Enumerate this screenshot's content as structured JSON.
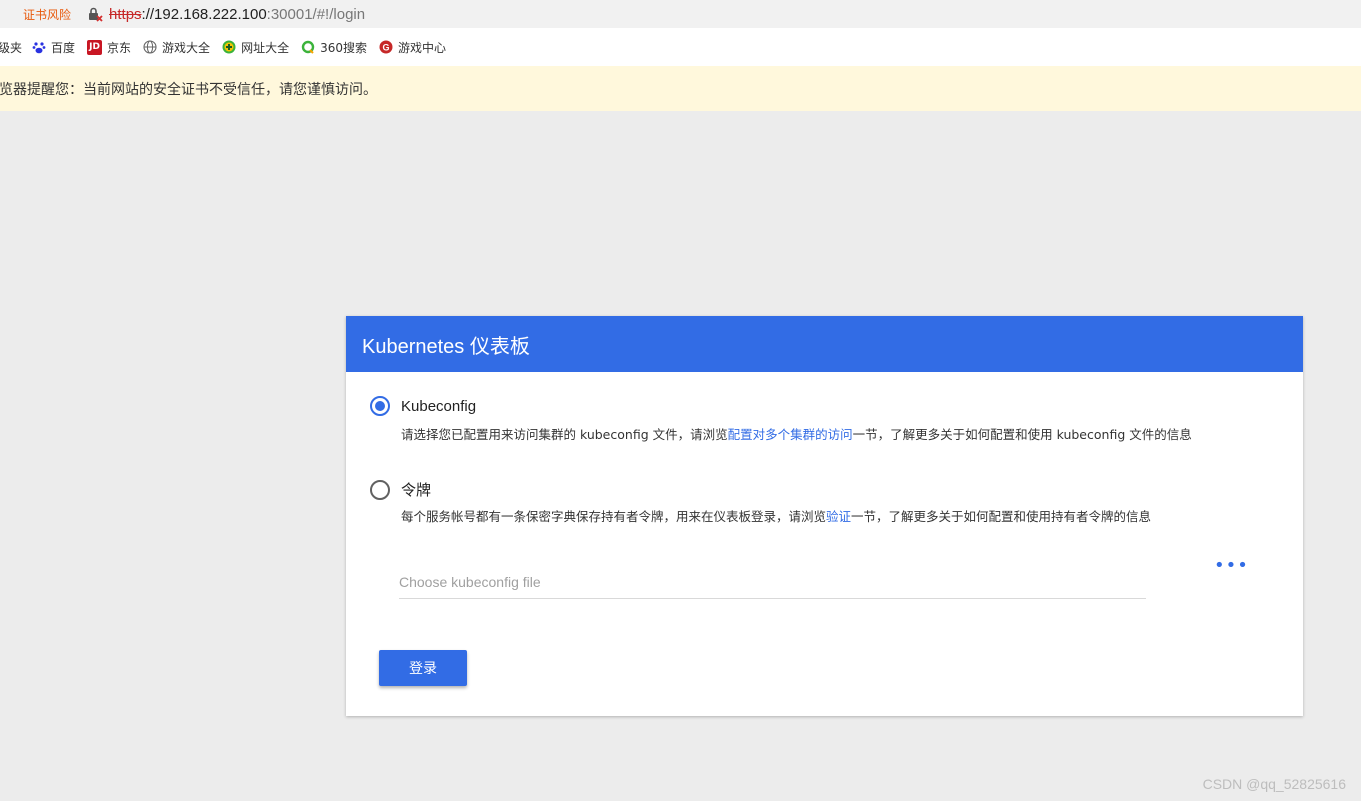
{
  "browser": {
    "cert_warning": "证书风险",
    "url_scheme": "https",
    "url_host": "://192.168.222.100",
    "url_rest": ":30001/#!/login",
    "bookmarks": [
      {
        "label": "级夹",
        "icon": "folder-icon"
      },
      {
        "label": "百度",
        "icon": "baidu-icon"
      },
      {
        "label": "京东",
        "icon": "jd-icon"
      },
      {
        "label": "游戏大全",
        "icon": "globe-icon"
      },
      {
        "label": "网址大全",
        "icon": "plus-circle-icon"
      },
      {
        "label": "360搜索",
        "icon": "search360-icon"
      },
      {
        "label": "游戏中心",
        "icon": "game-center-icon"
      }
    ],
    "security_warning": "览器提醒您：当前网站的安全证书不受信任，请您谨慎访问。"
  },
  "login": {
    "title": "Kubernetes 仪表板",
    "options": [
      {
        "label": "Kubeconfig",
        "selected": true,
        "desc_before": "请选择您已配置用来访问集群的 kubeconfig 文件，请浏览",
        "desc_link": "配置对多个集群的访问",
        "desc_after": "一节，了解更多关于如何配置和使用 kubeconfig 文件的信息"
      },
      {
        "label": "令牌",
        "selected": false,
        "desc_before": "每个服务帐号都有一条保密字典保存持有者令牌，用来在仪表板登录，请浏览",
        "desc_link": "验证",
        "desc_after": "一节，了解更多关于如何配置和使用持有者令牌的信息"
      }
    ],
    "file_placeholder": "Choose kubeconfig file",
    "more_label": "•••",
    "submit_label": "登录"
  },
  "watermark": "CSDN @qq_52825616",
  "colors": {
    "accent": "#326ce5",
    "warning_bg": "#fff8dc",
    "page_bg": "#ececec"
  }
}
